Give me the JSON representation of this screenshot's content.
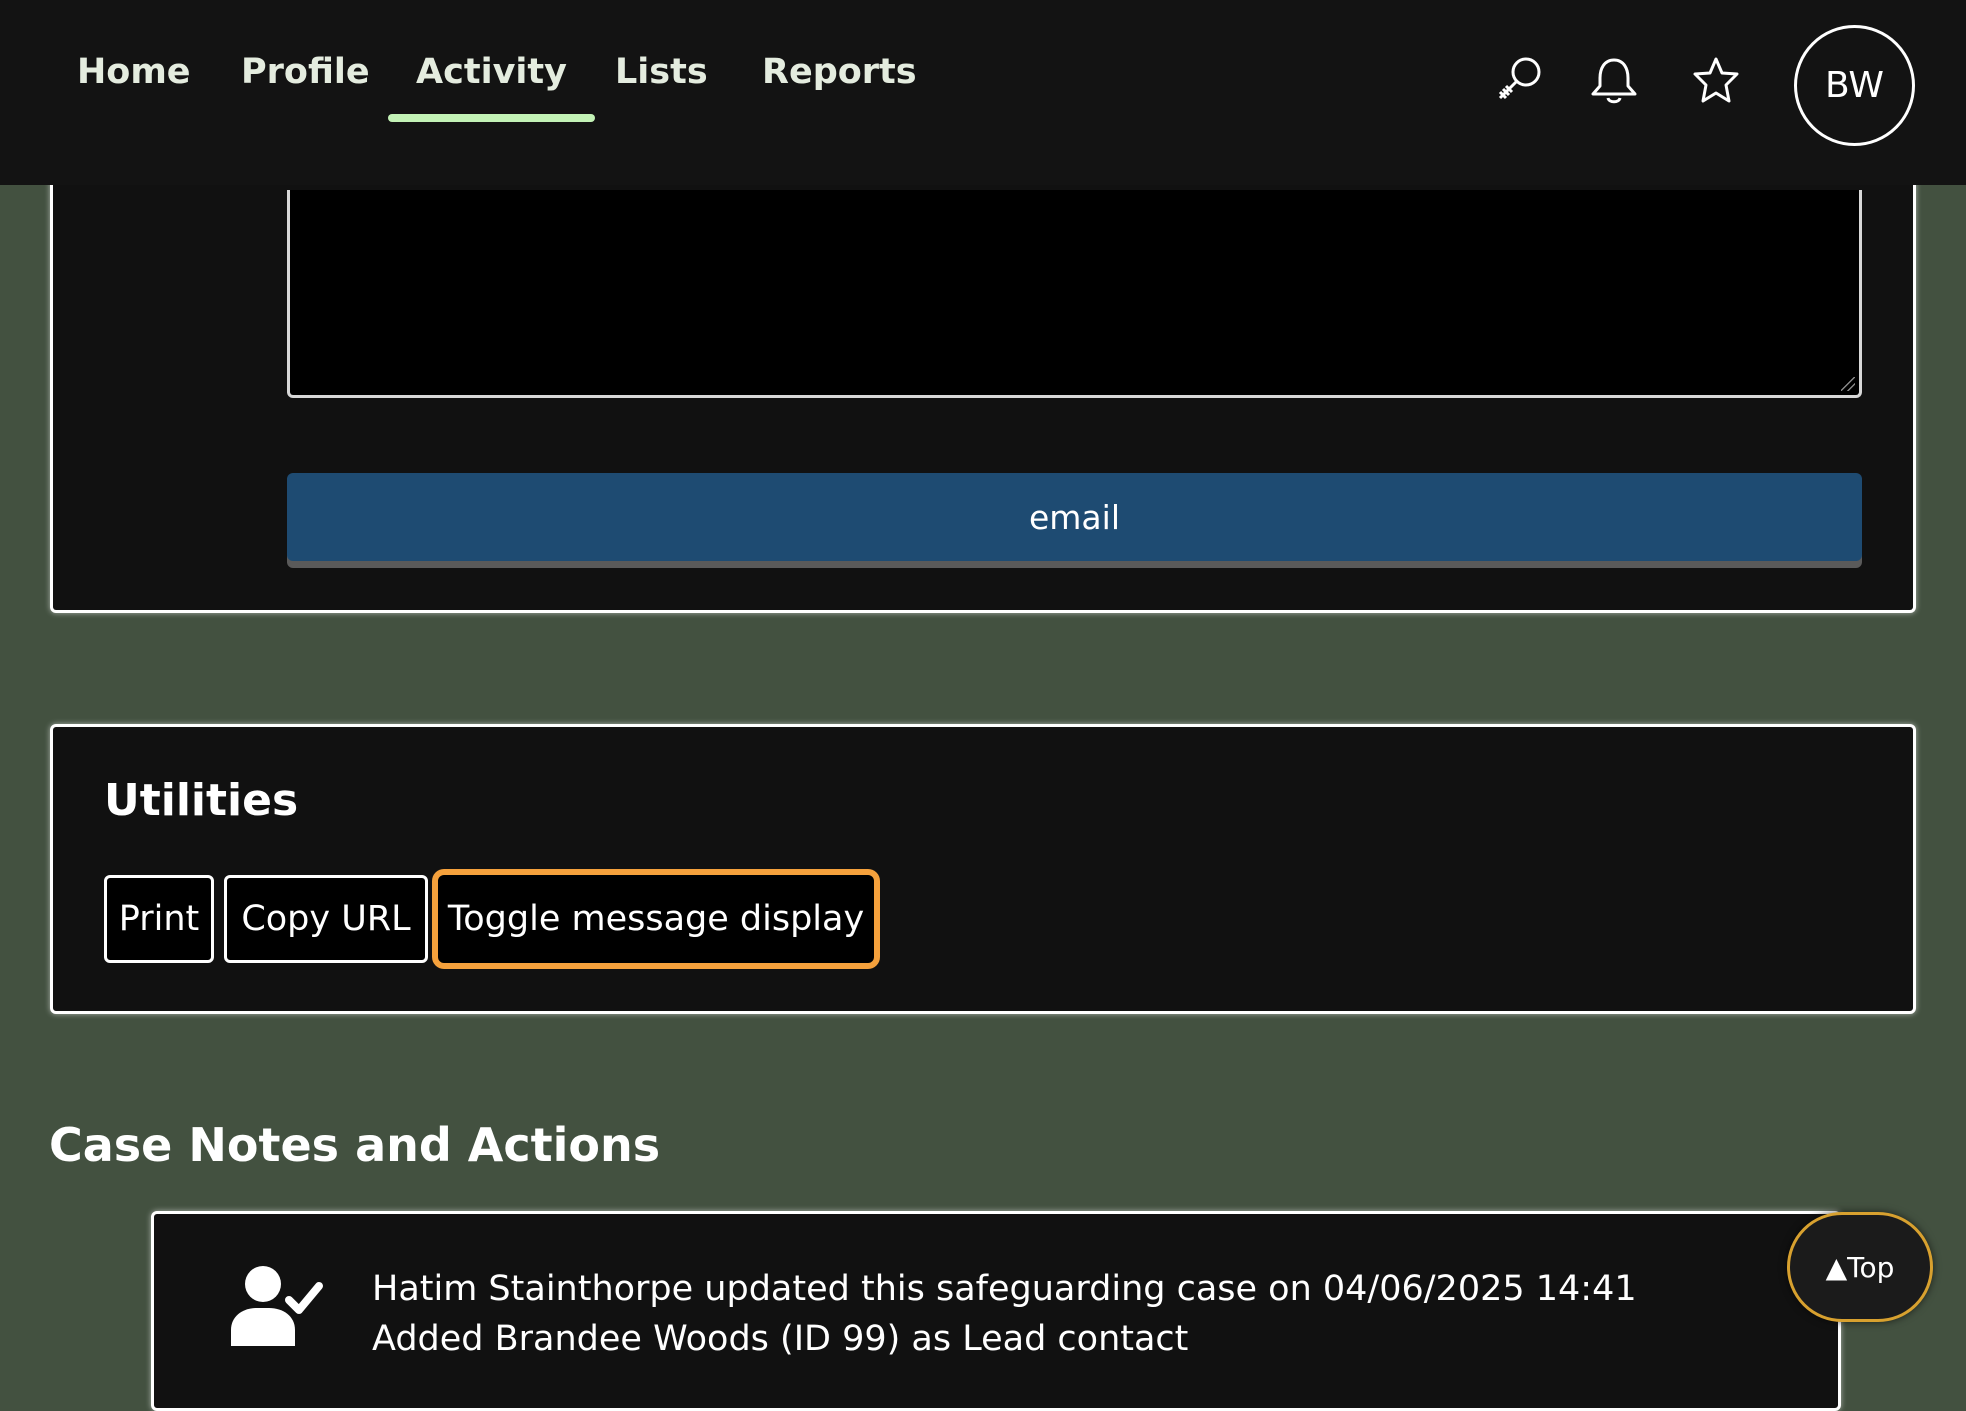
{
  "nav": {
    "items": [
      {
        "label": "Home"
      },
      {
        "label": "Profile"
      },
      {
        "label": "Activity",
        "active": true
      },
      {
        "label": "Lists"
      },
      {
        "label": "Reports"
      }
    ],
    "icons": [
      "search-icon",
      "bell-icon",
      "star-icon"
    ],
    "avatar_initials": "BW"
  },
  "email_form": {
    "button_label": "email"
  },
  "utilities": {
    "title": "Utilities",
    "buttons": [
      {
        "label": "Print"
      },
      {
        "label": "Copy URL"
      },
      {
        "label": "Toggle message display",
        "focused": true
      }
    ]
  },
  "case_notes": {
    "title": "Case Notes and Actions",
    "entries": [
      {
        "icon": "user-check-icon",
        "line1": "Hatim Stainthorpe updated this safeguarding case on 04/06/2025 14:41",
        "line2": "Added Brandee Woods (ID 99) as Lead contact"
      }
    ]
  },
  "back_to_top_label": "▲Top",
  "colors": {
    "page_background": "#435140",
    "topbar": "#131313",
    "active_tab_underline": "#c3f2b6",
    "email_button": "#1e4b72",
    "focus_ring": "#f5a13c",
    "top_button_border": "#d8a12f"
  }
}
